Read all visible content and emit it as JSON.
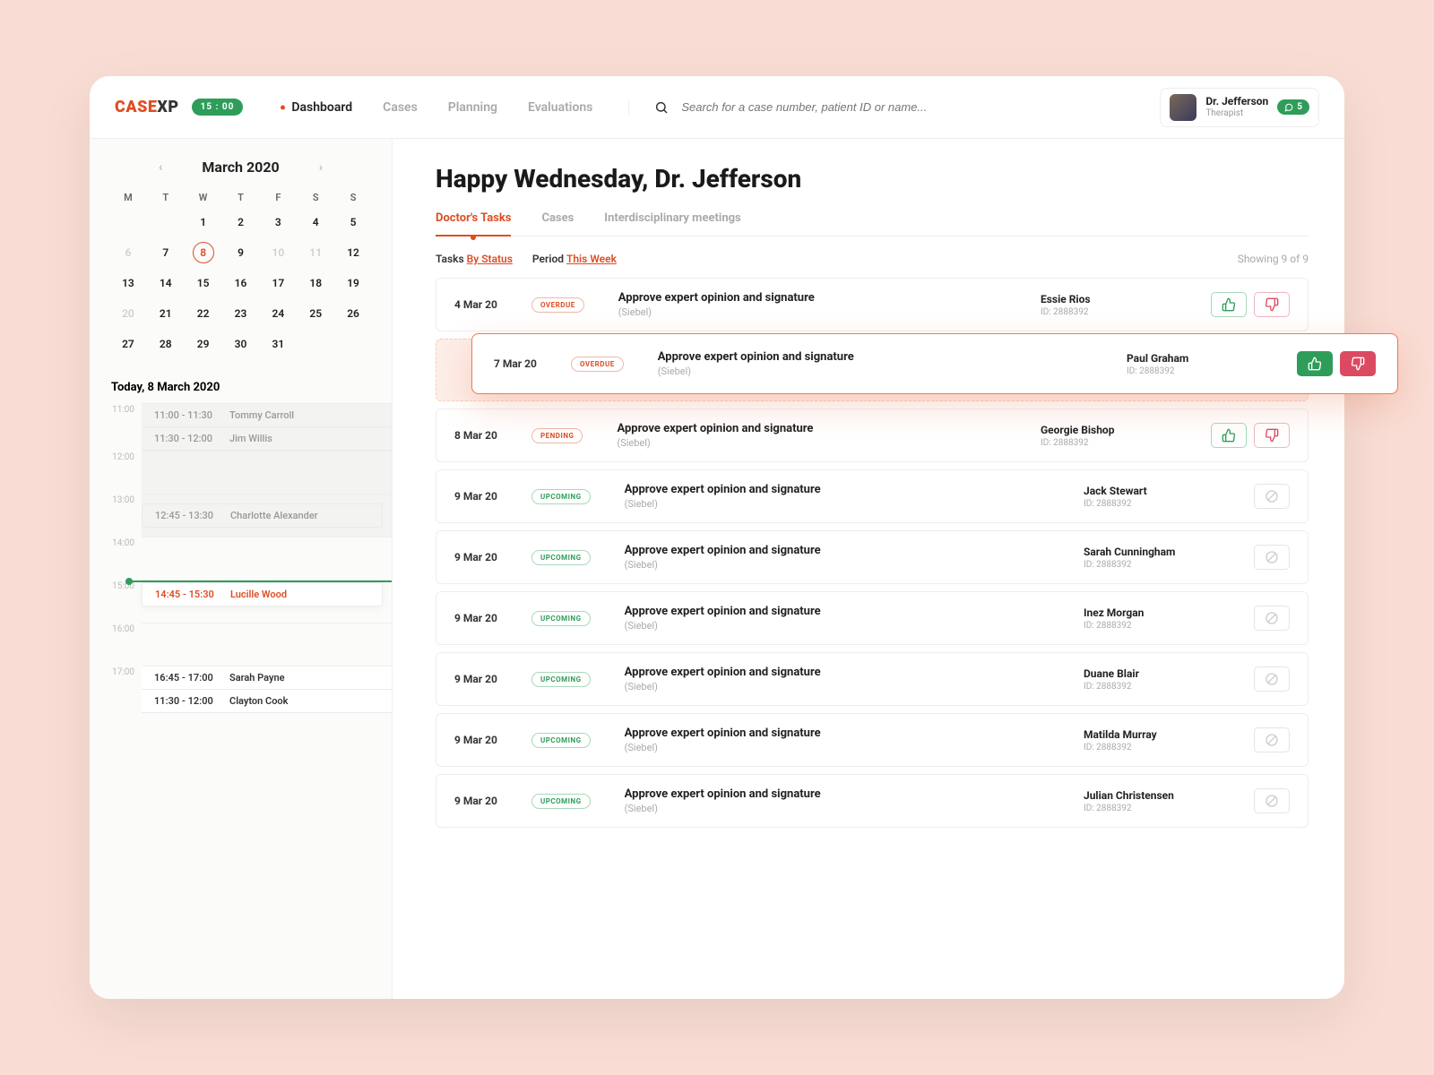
{
  "brand": {
    "part1": "CASE",
    "part2": "XP"
  },
  "clock": "15 : 00",
  "nav": [
    "Dashboard",
    "Cases",
    "Planning",
    "Evaluations"
  ],
  "nav_active": 0,
  "search_placeholder": "Search for a case number, patient ID or name...",
  "user": {
    "name": "Dr. Jefferson",
    "role": "Therapist",
    "messages": "5"
  },
  "calendar": {
    "month": "March 2020",
    "dow": [
      "M",
      "T",
      "W",
      "T",
      "F",
      "S",
      "S"
    ],
    "weeks": [
      [
        null,
        null,
        null,
        null,
        null,
        "1",
        "2"
      ],
      [
        "3",
        "4",
        "5",
        "6",
        "7",
        "8",
        "9"
      ],
      [
        "10",
        "11",
        "12",
        "13",
        "14",
        "15",
        "16"
      ],
      [
        "17",
        "18",
        "19",
        "20",
        "21",
        "22",
        "23"
      ],
      [
        "24",
        "25",
        "26",
        "27",
        "28",
        "29",
        "30"
      ],
      [
        "31",
        null,
        null,
        null,
        null,
        null,
        null
      ]
    ],
    "display_rows": [
      {
        "cells": [
          {
            "v": "",
            "m": true
          },
          {
            "v": "",
            "m": true
          },
          {
            "v": "1"
          },
          {
            "v": "2"
          },
          {
            "v": "3"
          },
          {
            "v": "4"
          },
          {
            "v": "5"
          }
        ]
      },
      {
        "cells": [
          {
            "v": "6",
            "m": true
          },
          {
            "v": "7"
          },
          {
            "v": "8",
            "sel": true
          },
          {
            "v": "9"
          },
          {
            "v": "10",
            "m": true
          },
          {
            "v": "11",
            "m": true
          },
          {
            "v": "12"
          }
        ]
      },
      {
        "cells": [
          {
            "v": "13"
          },
          {
            "v": "14"
          },
          {
            "v": "15"
          },
          {
            "v": "16"
          },
          {
            "v": "17"
          },
          {
            "v": "18"
          },
          {
            "v": "19"
          }
        ]
      },
      {
        "cells": [
          {
            "v": "20",
            "m": true
          },
          {
            "v": "21"
          },
          {
            "v": "22"
          },
          {
            "v": "23"
          },
          {
            "v": "24"
          },
          {
            "v": "25"
          },
          {
            "v": "26"
          }
        ]
      },
      {
        "cells": [
          {
            "v": "27"
          },
          {
            "v": "28"
          },
          {
            "v": "29"
          },
          {
            "v": "30"
          },
          {
            "v": "31"
          },
          {
            "v": "",
            "m": true
          },
          {
            "v": "",
            "m": true
          }
        ]
      }
    ],
    "today_label": "Today,  8 March 2020"
  },
  "schedule": {
    "hours": [
      "11:00",
      "12:00",
      "13:00",
      "14:00",
      "15:00",
      "16:00",
      "17:00"
    ],
    "past_appts": [
      {
        "time": "11:00 - 11:30",
        "name": "Tommy Carroll"
      },
      {
        "time": "11:30 - 12:00",
        "name": "Jim Willis"
      }
    ],
    "mid_appt": {
      "time": "12:45 - 13:30",
      "name": "Charlotte Alexander"
    },
    "current": {
      "time": "14:45 - 15:30",
      "name": "Lucille Wood"
    },
    "later": [
      {
        "time": "16:45 - 17:00",
        "name": "Sarah Payne"
      },
      {
        "time": "11:30 - 12:00",
        "name": "Clayton Cook"
      }
    ]
  },
  "main": {
    "greeting": "Happy Wednesday, Dr. Jefferson",
    "tabs": [
      "Doctor's Tasks",
      "Cases",
      "Interdisciplinary meetings"
    ],
    "tabs_active": 0,
    "filter_tasks_label": "Tasks",
    "filter_tasks_link": "By Status",
    "filter_period_label": "Period",
    "filter_period_link": "This Week",
    "count": "Showing 9 of 9"
  },
  "tasks": [
    {
      "date": "4 Mar 20",
      "status": "OVERDUE",
      "pill": "overdue",
      "title": "Approve expert opinion and signature",
      "sub": "(Siebel)",
      "person": "Essie Rios",
      "pid": "ID: 2888392",
      "act": "outline"
    },
    {
      "float": true,
      "date": "7 Mar 20",
      "status": "OVERDUE",
      "pill": "overdue",
      "title": "Approve expert opinion and signature",
      "sub": "(Siebel)",
      "person": "Paul Graham",
      "pid": "ID: 2888392",
      "act": "filled"
    },
    {
      "date": "8 Mar 20",
      "status": "PENDING",
      "pill": "pending",
      "title": "Approve expert opinion and signature",
      "sub": "(Siebel)",
      "person": "Georgie Bishop",
      "pid": "ID: 2888392",
      "act": "outline"
    },
    {
      "date": "9 Mar 20",
      "status": "UPCOMING",
      "pill": "upcoming",
      "title": "Approve expert opinion and signature",
      "sub": "(Siebel)",
      "person": "Jack Stewart",
      "pid": "ID: 2888392",
      "act": "na"
    },
    {
      "date": "9 Mar 20",
      "status": "UPCOMING",
      "pill": "upcoming",
      "title": "Approve expert opinion and signature",
      "sub": "(Siebel)",
      "person": "Sarah Cunningham",
      "pid": "ID: 2888392",
      "act": "na"
    },
    {
      "date": "9 Mar 20",
      "status": "UPCOMING",
      "pill": "upcoming",
      "title": "Approve expert opinion and signature",
      "sub": "(Siebel)",
      "person": "Inez Morgan",
      "pid": "ID: 2888392",
      "act": "na"
    },
    {
      "date": "9 Mar 20",
      "status": "UPCOMING",
      "pill": "upcoming",
      "title": "Approve expert opinion and signature",
      "sub": "(Siebel)",
      "person": "Duane Blair",
      "pid": "ID: 2888392",
      "act": "na"
    },
    {
      "date": "9 Mar 20",
      "status": "UPCOMING",
      "pill": "upcoming",
      "title": "Approve expert opinion and signature",
      "sub": "(Siebel)",
      "person": "Matilda Murray",
      "pid": "ID: 2888392",
      "act": "na"
    },
    {
      "date": "9 Mar 20",
      "status": "UPCOMING",
      "pill": "upcoming",
      "title": "Approve expert opinion and signature",
      "sub": "(Siebel)",
      "person": "Julian Christensen",
      "pid": "ID: 2888392",
      "act": "na"
    }
  ]
}
